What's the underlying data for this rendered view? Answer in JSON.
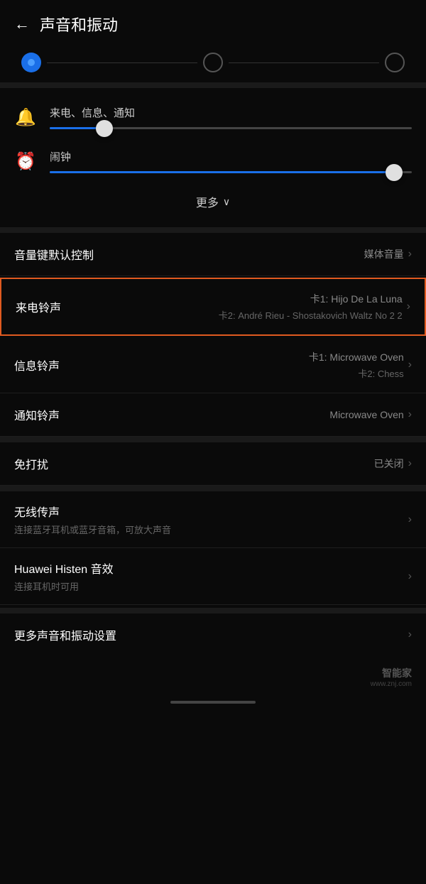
{
  "header": {
    "back_label": "←",
    "title": "声音和振动"
  },
  "tabs": [
    {
      "id": "tab1",
      "state": "active"
    },
    {
      "id": "tab2",
      "state": "inactive"
    },
    {
      "id": "tab3",
      "state": "inactive"
    }
  ],
  "volume": {
    "ringtone_label": "来电、信息、通知",
    "ringtone_value": 15,
    "alarm_label": "闹钟",
    "alarm_value": 95
  },
  "more": {
    "label": "更多",
    "chevron": "∨"
  },
  "settings": [
    {
      "id": "volume-key",
      "label": "音量键默认控制",
      "value": "媒体音量",
      "sub_value": "",
      "highlighted": false
    },
    {
      "id": "ringtone",
      "label": "来电铃声",
      "value": "卡1: Hijo De La Luna",
      "sub_value": "卡2: André Rieu - Shostakovich Waltz No 2 2",
      "highlighted": true
    },
    {
      "id": "message-ringtone",
      "label": "信息铃声",
      "value": "卡1: Microwave Oven",
      "sub_value": "卡2: Chess",
      "highlighted": false
    },
    {
      "id": "notification-ringtone",
      "label": "通知铃声",
      "value": "Microwave Oven",
      "sub_value": "",
      "highlighted": false
    }
  ],
  "dnd": {
    "label": "免打扰",
    "value": "已关闭"
  },
  "wireless": [
    {
      "id": "wireless-audio",
      "title": "无线传声",
      "subtitle": "连接蓝牙耳机或蓝牙音箱，可放大声音"
    },
    {
      "id": "histen",
      "title": "Huawei Histen 音效",
      "subtitle": "连接耳机时可用"
    }
  ],
  "more_settings": {
    "label": "更多声音和振动设置"
  },
  "watermark": {
    "text": "",
    "logo_main": "智能家",
    "logo_sub": "www.znj.com"
  }
}
